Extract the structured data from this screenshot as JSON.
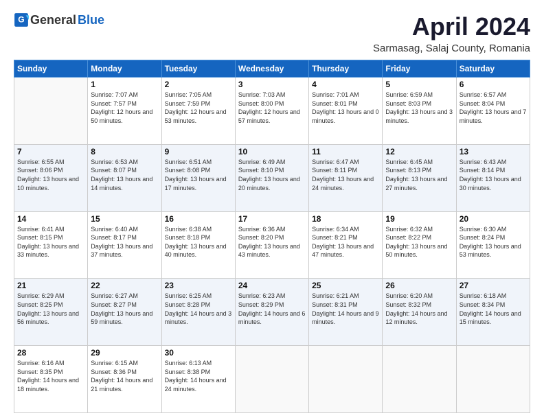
{
  "logo": {
    "general": "General",
    "blue": "Blue"
  },
  "title": "April 2024",
  "location": "Sarmasag, Salaj County, Romania",
  "days_of_week": [
    "Sunday",
    "Monday",
    "Tuesday",
    "Wednesday",
    "Thursday",
    "Friday",
    "Saturday"
  ],
  "weeks": [
    [
      {
        "day": "",
        "sunrise": "",
        "sunset": "",
        "daylight": ""
      },
      {
        "day": "1",
        "sunrise": "Sunrise: 7:07 AM",
        "sunset": "Sunset: 7:57 PM",
        "daylight": "Daylight: 12 hours and 50 minutes."
      },
      {
        "day": "2",
        "sunrise": "Sunrise: 7:05 AM",
        "sunset": "Sunset: 7:59 PM",
        "daylight": "Daylight: 12 hours and 53 minutes."
      },
      {
        "day": "3",
        "sunrise": "Sunrise: 7:03 AM",
        "sunset": "Sunset: 8:00 PM",
        "daylight": "Daylight: 12 hours and 57 minutes."
      },
      {
        "day": "4",
        "sunrise": "Sunrise: 7:01 AM",
        "sunset": "Sunset: 8:01 PM",
        "daylight": "Daylight: 13 hours and 0 minutes."
      },
      {
        "day": "5",
        "sunrise": "Sunrise: 6:59 AM",
        "sunset": "Sunset: 8:03 PM",
        "daylight": "Daylight: 13 hours and 3 minutes."
      },
      {
        "day": "6",
        "sunrise": "Sunrise: 6:57 AM",
        "sunset": "Sunset: 8:04 PM",
        "daylight": "Daylight: 13 hours and 7 minutes."
      }
    ],
    [
      {
        "day": "7",
        "sunrise": "Sunrise: 6:55 AM",
        "sunset": "Sunset: 8:06 PM",
        "daylight": "Daylight: 13 hours and 10 minutes."
      },
      {
        "day": "8",
        "sunrise": "Sunrise: 6:53 AM",
        "sunset": "Sunset: 8:07 PM",
        "daylight": "Daylight: 13 hours and 14 minutes."
      },
      {
        "day": "9",
        "sunrise": "Sunrise: 6:51 AM",
        "sunset": "Sunset: 8:08 PM",
        "daylight": "Daylight: 13 hours and 17 minutes."
      },
      {
        "day": "10",
        "sunrise": "Sunrise: 6:49 AM",
        "sunset": "Sunset: 8:10 PM",
        "daylight": "Daylight: 13 hours and 20 minutes."
      },
      {
        "day": "11",
        "sunrise": "Sunrise: 6:47 AM",
        "sunset": "Sunset: 8:11 PM",
        "daylight": "Daylight: 13 hours and 24 minutes."
      },
      {
        "day": "12",
        "sunrise": "Sunrise: 6:45 AM",
        "sunset": "Sunset: 8:13 PM",
        "daylight": "Daylight: 13 hours and 27 minutes."
      },
      {
        "day": "13",
        "sunrise": "Sunrise: 6:43 AM",
        "sunset": "Sunset: 8:14 PM",
        "daylight": "Daylight: 13 hours and 30 minutes."
      }
    ],
    [
      {
        "day": "14",
        "sunrise": "Sunrise: 6:41 AM",
        "sunset": "Sunset: 8:15 PM",
        "daylight": "Daylight: 13 hours and 33 minutes."
      },
      {
        "day": "15",
        "sunrise": "Sunrise: 6:40 AM",
        "sunset": "Sunset: 8:17 PM",
        "daylight": "Daylight: 13 hours and 37 minutes."
      },
      {
        "day": "16",
        "sunrise": "Sunrise: 6:38 AM",
        "sunset": "Sunset: 8:18 PM",
        "daylight": "Daylight: 13 hours and 40 minutes."
      },
      {
        "day": "17",
        "sunrise": "Sunrise: 6:36 AM",
        "sunset": "Sunset: 8:20 PM",
        "daylight": "Daylight: 13 hours and 43 minutes."
      },
      {
        "day": "18",
        "sunrise": "Sunrise: 6:34 AM",
        "sunset": "Sunset: 8:21 PM",
        "daylight": "Daylight: 13 hours and 47 minutes."
      },
      {
        "day": "19",
        "sunrise": "Sunrise: 6:32 AM",
        "sunset": "Sunset: 8:22 PM",
        "daylight": "Daylight: 13 hours and 50 minutes."
      },
      {
        "day": "20",
        "sunrise": "Sunrise: 6:30 AM",
        "sunset": "Sunset: 8:24 PM",
        "daylight": "Daylight: 13 hours and 53 minutes."
      }
    ],
    [
      {
        "day": "21",
        "sunrise": "Sunrise: 6:29 AM",
        "sunset": "Sunset: 8:25 PM",
        "daylight": "Daylight: 13 hours and 56 minutes."
      },
      {
        "day": "22",
        "sunrise": "Sunrise: 6:27 AM",
        "sunset": "Sunset: 8:27 PM",
        "daylight": "Daylight: 13 hours and 59 minutes."
      },
      {
        "day": "23",
        "sunrise": "Sunrise: 6:25 AM",
        "sunset": "Sunset: 8:28 PM",
        "daylight": "Daylight: 14 hours and 3 minutes."
      },
      {
        "day": "24",
        "sunrise": "Sunrise: 6:23 AM",
        "sunset": "Sunset: 8:29 PM",
        "daylight": "Daylight: 14 hours and 6 minutes."
      },
      {
        "day": "25",
        "sunrise": "Sunrise: 6:21 AM",
        "sunset": "Sunset: 8:31 PM",
        "daylight": "Daylight: 14 hours and 9 minutes."
      },
      {
        "day": "26",
        "sunrise": "Sunrise: 6:20 AM",
        "sunset": "Sunset: 8:32 PM",
        "daylight": "Daylight: 14 hours and 12 minutes."
      },
      {
        "day": "27",
        "sunrise": "Sunrise: 6:18 AM",
        "sunset": "Sunset: 8:34 PM",
        "daylight": "Daylight: 14 hours and 15 minutes."
      }
    ],
    [
      {
        "day": "28",
        "sunrise": "Sunrise: 6:16 AM",
        "sunset": "Sunset: 8:35 PM",
        "daylight": "Daylight: 14 hours and 18 minutes."
      },
      {
        "day": "29",
        "sunrise": "Sunrise: 6:15 AM",
        "sunset": "Sunset: 8:36 PM",
        "daylight": "Daylight: 14 hours and 21 minutes."
      },
      {
        "day": "30",
        "sunrise": "Sunrise: 6:13 AM",
        "sunset": "Sunset: 8:38 PM",
        "daylight": "Daylight: 14 hours and 24 minutes."
      },
      {
        "day": "",
        "sunrise": "",
        "sunset": "",
        "daylight": ""
      },
      {
        "day": "",
        "sunrise": "",
        "sunset": "",
        "daylight": ""
      },
      {
        "day": "",
        "sunrise": "",
        "sunset": "",
        "daylight": ""
      },
      {
        "day": "",
        "sunrise": "",
        "sunset": "",
        "daylight": ""
      }
    ]
  ]
}
